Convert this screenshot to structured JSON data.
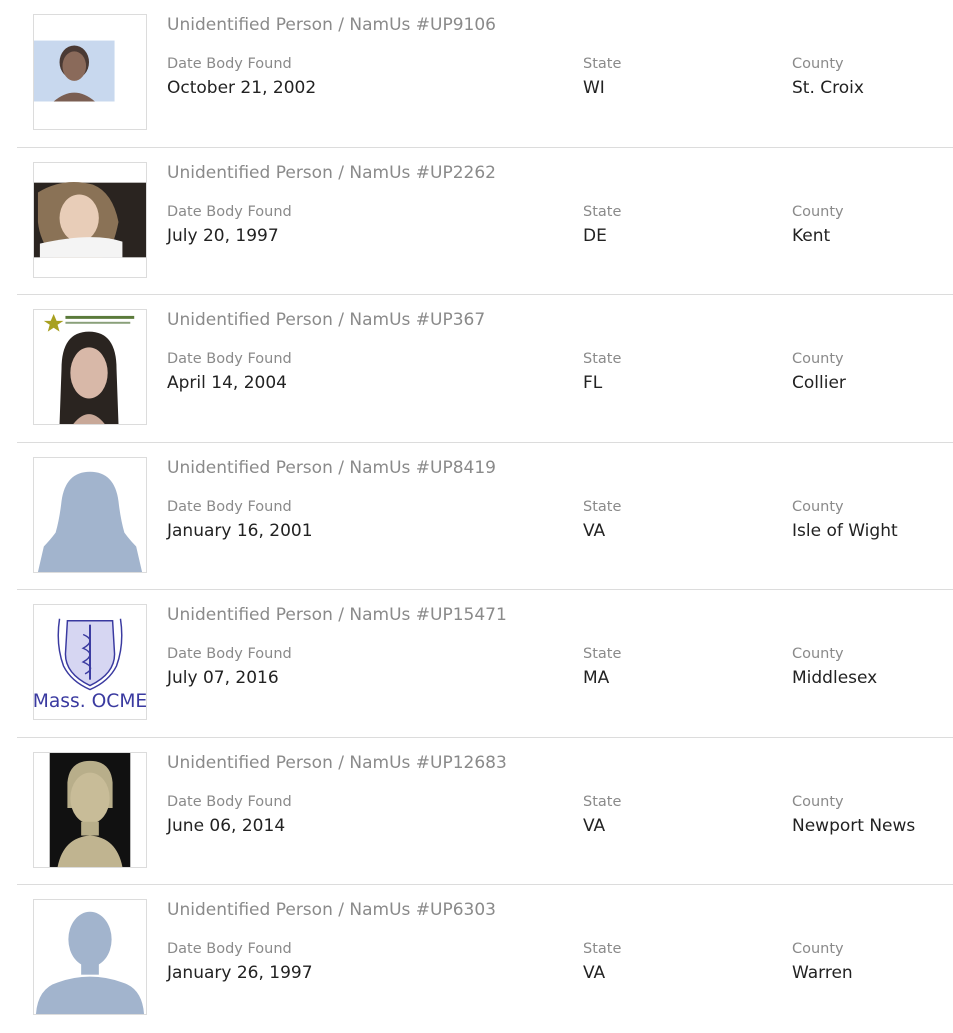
{
  "colors": {
    "title": "#8a8a8a",
    "label": "#8a8a8a",
    "value": "#222222",
    "divider": "#dcdcdc",
    "silhouette": "#a2b4cd",
    "ocme_blue": "#3a3aa0"
  },
  "labels": {
    "date": "Date Body Found",
    "state": "State",
    "county": "County"
  },
  "cases": [
    {
      "title": "Unidentified Person / NamUs #UP9106",
      "date": "October 21, 2002",
      "state": "WI",
      "county": "St. Croix",
      "image": "facial-reconstruction-photo"
    },
    {
      "title": "Unidentified Person / NamUs #UP2262",
      "date": "July 20, 1997",
      "state": "DE",
      "county": "Kent",
      "image": "facial-reconstruction-photo"
    },
    {
      "title": "Unidentified Person / NamUs #UP367",
      "date": "April 14, 2004",
      "state": "FL",
      "county": "Collier",
      "image": "sheriff-office-sketch"
    },
    {
      "title": "Unidentified Person / NamUs #UP8419",
      "date": "January 16, 2001",
      "state": "VA",
      "county": "Isle of Wight",
      "image": "female-silhouette"
    },
    {
      "title": "Unidentified Person / NamUs #UP15471",
      "date": "July 07, 2016",
      "state": "MA",
      "county": "Middlesex",
      "image": "mass-ocme-logo",
      "logo_text": "Mass. OCME"
    },
    {
      "title": "Unidentified Person / NamUs #UP12683",
      "date": "June 06, 2014",
      "state": "VA",
      "county": "Newport News",
      "image": "clay-reconstruction-photo"
    },
    {
      "title": "Unidentified Person / NamUs #UP6303",
      "date": "January 26, 1997",
      "state": "VA",
      "county": "Warren",
      "image": "male-silhouette"
    }
  ]
}
